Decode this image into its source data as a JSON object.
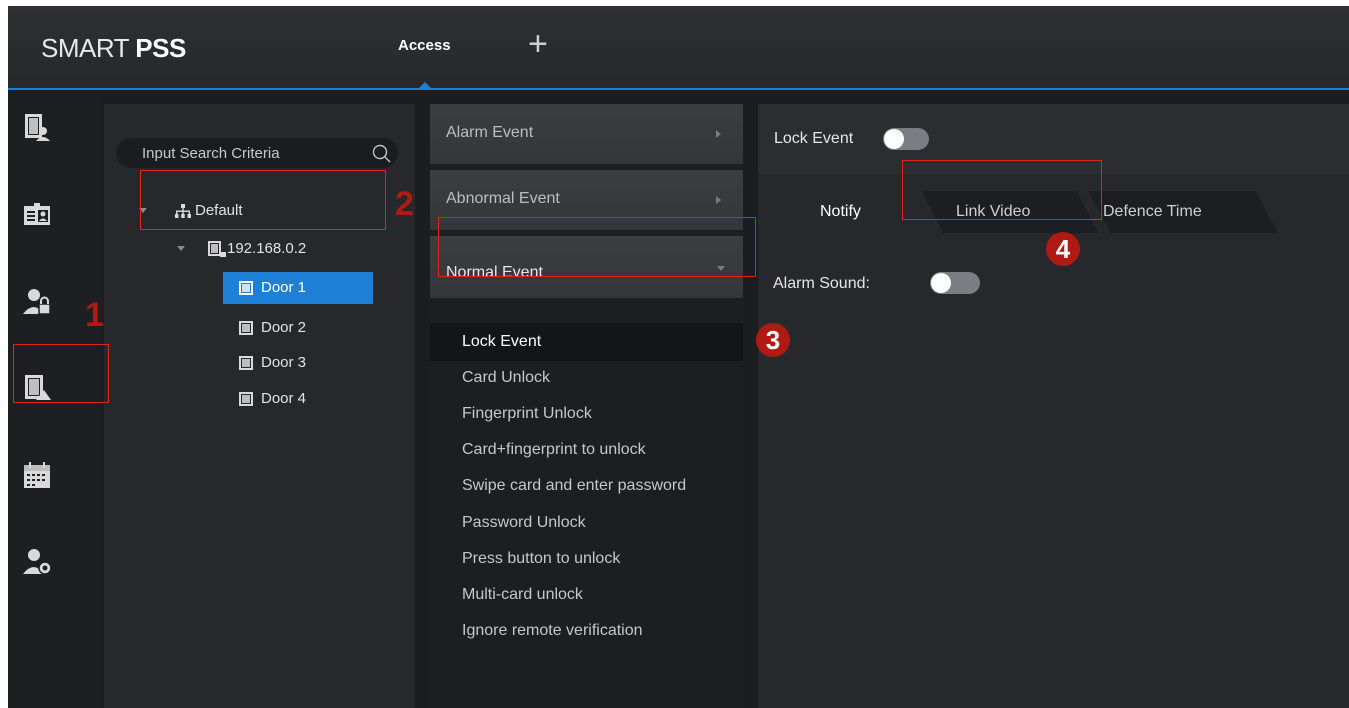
{
  "app": {
    "logo_light": "SMART ",
    "logo_bold": "PSS",
    "active_tab": "Access",
    "add_tab_glyph": "+",
    "accent_color": "#1e7fd6"
  },
  "sidebar_icons": [
    "door-user-icon",
    "id-card-icon",
    "user-lock-icon",
    "door-config-icon",
    "calendar-icon",
    "user-settings-icon"
  ],
  "tree": {
    "search_placeholder": "Input Search Criteria",
    "root": "Default",
    "device": "192.168.0.2",
    "doors": [
      "Door 1",
      "Door 2",
      "Door 3",
      "Door 4"
    ],
    "selected_door": "Door 1"
  },
  "events": {
    "groups": [
      "Alarm Event",
      "Abnormal Event",
      "Normal Event"
    ],
    "items": [
      "Lock Event",
      "Card Unlock",
      "Fingerprint Unlock",
      "Card+fingerprint to unlock",
      "Swipe card and enter password",
      "Password Unlock",
      "Press button to unlock",
      "Multi-card unlock",
      "Ignore remote verification"
    ],
    "active_item": "Lock Event"
  },
  "settings": {
    "event_label": "Lock Event",
    "tabs": [
      "Notify",
      "Link Video",
      "Defence Time"
    ],
    "alarm_sound_label": "Alarm Sound:"
  },
  "annotations": {
    "badge_1": "1",
    "badge_2": "2",
    "badge_3": "3",
    "badge_4": "4",
    "annotation_color": "#e0251b"
  }
}
